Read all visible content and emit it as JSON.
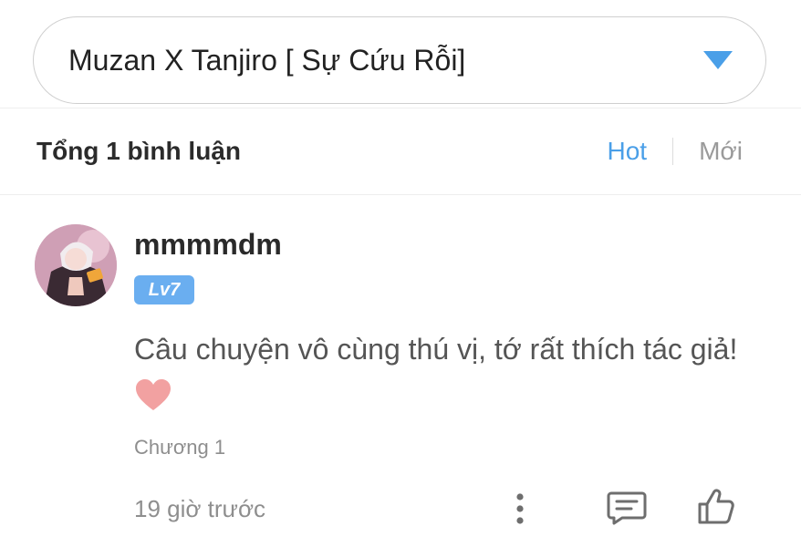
{
  "chapter_selector": {
    "title": "Muzan X Tanjiro [ Sự Cứu Rỗi]",
    "arrow_icon": "dropdown-triangle-icon",
    "accent_color": "#4a9fe8"
  },
  "comments_header": {
    "total_label": "Tổng 1 bình luận",
    "sort_hot": "Hot",
    "sort_new": "Mới",
    "active_sort": "Hot"
  },
  "comment": {
    "username": "mmmmdm",
    "level": "Lv7",
    "text": "Câu chuyện vô cùng thú vị, tớ rất thích tác giả!",
    "emoji": "heart",
    "chapter": "Chương 1",
    "time": "19 giờ trước",
    "actions": [
      "more-options-icon",
      "reply-icon",
      "like-icon"
    ]
  }
}
